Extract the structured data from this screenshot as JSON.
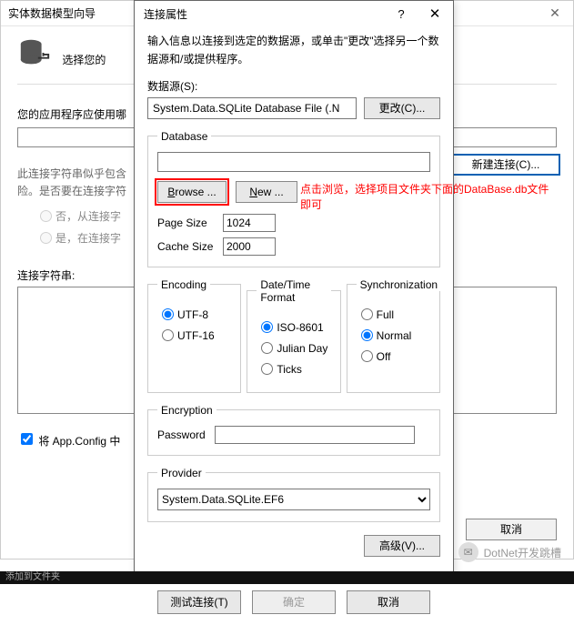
{
  "bg": {
    "title": "实体数据模型向导",
    "heading_prefix": "选择您的",
    "q1": "您的应用程序应使用哪",
    "new_conn": "新建连接(C)...",
    "desc_l1": "此连接字符串似乎包含",
    "desc_l2": "险。是否要在连接字符",
    "radio_no": "否，从连接字",
    "radio_yes": "是，在连接字",
    "connstr_label": "连接字符串:",
    "checkbox": "将 App.Config 中",
    "cancel": "取消"
  },
  "fg": {
    "title": "连接属性",
    "intro": "输入信息以连接到选定的数据源，或单击\"更改\"选择另一个数据源和/或提供程序。",
    "ds_label": "数据源(S):",
    "ds_value": "System.Data.SQLite Database File (.N",
    "change": "更改(C)...",
    "db_legend": "Database",
    "browse": "Browse ...",
    "new": "New ...",
    "page_size_label": "Page Size",
    "page_size": "1024",
    "cache_size_label": "Cache Size",
    "cache_size": "2000",
    "encoding_legend": "Encoding",
    "enc_utf8": "UTF-8",
    "enc_utf16": "UTF-16",
    "dtf_legend": "Date/Time Format",
    "dtf_iso": "ISO-8601",
    "dtf_julian": "Julian Day",
    "dtf_ticks": "Ticks",
    "sync_legend": "Synchronization",
    "sync_full": "Full",
    "sync_normal": "Normal",
    "sync_off": "Off",
    "enc_legend": "Encryption",
    "password_label": "Password",
    "provider_legend": "Provider",
    "provider_value": "System.Data.SQLite.EF6",
    "advanced": "高级(V)...",
    "test": "测试连接(T)",
    "ok": "确定",
    "cancel": "取消"
  },
  "annotation_l1": "点击浏览，选择项目文件夹下面的DataBase.db文件",
  "annotation_l2": "即可",
  "weixin": "DotNet开发跳槽",
  "blackbar": "添加到文件夹"
}
